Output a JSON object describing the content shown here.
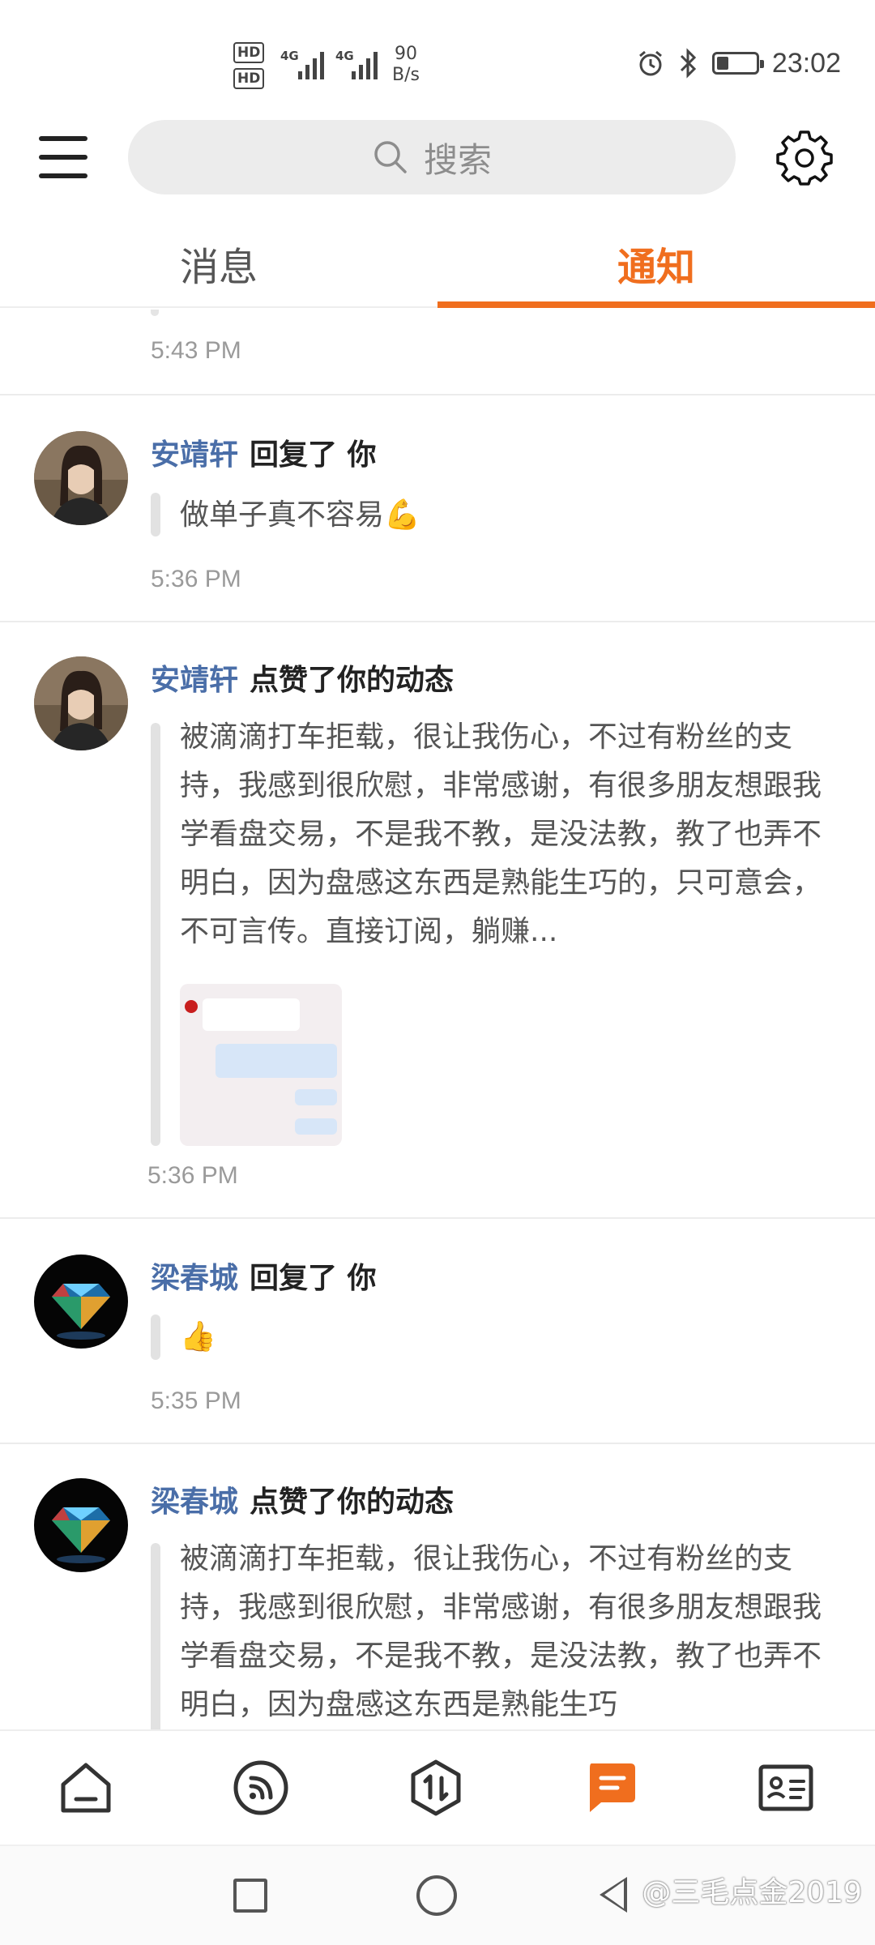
{
  "status_bar": {
    "hd1": "HD",
    "hd2": "HD",
    "net1": "4G",
    "net2": "4G",
    "speed_value": "90",
    "speed_unit": "B/s",
    "time": "23:02",
    "battery_level": 0.3
  },
  "header": {
    "search_placeholder": "搜索"
  },
  "tabs": [
    {
      "label": "消息",
      "active": false
    },
    {
      "label": "通知",
      "active": true
    }
  ],
  "feed": {
    "first_time": "5:43 PM",
    "items": [
      {
        "user": "安靖轩",
        "action": "回复了 你",
        "text": "做单子真不容易💪",
        "time": "5:36 PM"
      },
      {
        "user": "安靖轩",
        "action": "点赞了你的动态",
        "text": "被滴滴打车拒载，很让我伤心，不过有粉丝的支持，我感到很欣慰，非常感谢，有很多朋友想跟我学看盘交易，不是我不教，是没法教，教了也弄不明白，因为盘感这东西是熟能生巧的，只可意会，不可言传。直接订阅，躺赚...",
        "time": "5:36 PM"
      },
      {
        "user": "梁春城",
        "action": "回复了 你",
        "text": "👍",
        "time": "5:35 PM"
      },
      {
        "user": "梁春城",
        "action": "点赞了你的动态",
        "text": "被滴滴打车拒载，很让我伤心，不过有粉丝的支持，我感到很欣慰，非常感谢，有很多朋友想跟我学看盘交易，不是我不教，是没法教，教了也弄不明白，因为盘感这东西是熟能生巧"
      }
    ]
  },
  "bottom_nav": [
    {
      "name": "home-icon",
      "active": false
    },
    {
      "name": "feed-icon",
      "active": false
    },
    {
      "name": "trade-icon",
      "active": false
    },
    {
      "name": "message-icon",
      "active": true
    },
    {
      "name": "profile-card-icon",
      "active": false
    }
  ],
  "watermark": "@三毛点金2019",
  "colors": {
    "accent": "#f06e1e",
    "username": "#4a6ea8"
  }
}
